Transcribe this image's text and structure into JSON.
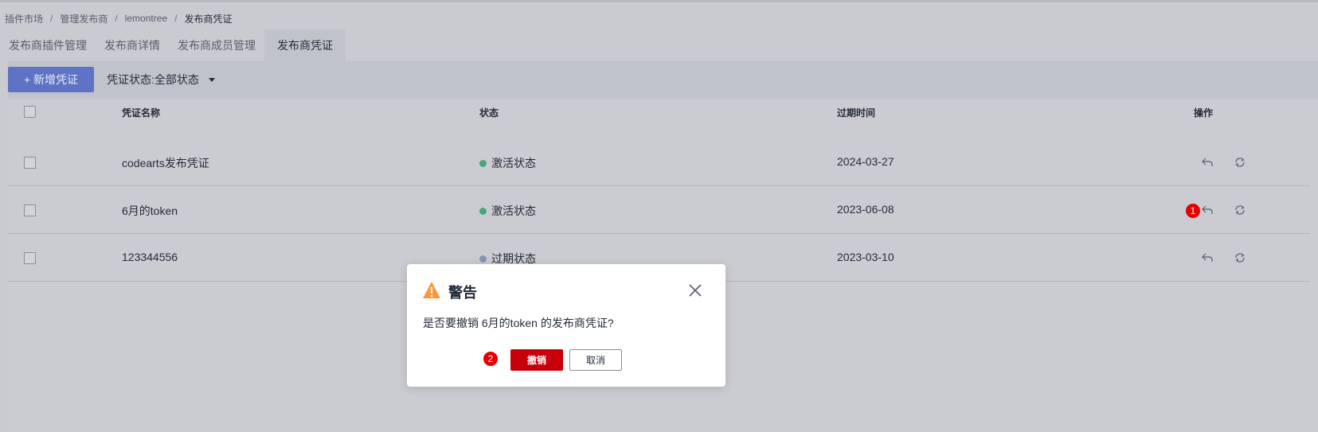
{
  "breadcrumb": {
    "items": [
      "插件市场",
      "管理发布商",
      "lemontree",
      "发布商凭证"
    ],
    "separator": "/"
  },
  "tabs": [
    {
      "label": "发布商插件管理",
      "active": false
    },
    {
      "label": "发布商详情",
      "active": false
    },
    {
      "label": "发布商成员管理",
      "active": false
    },
    {
      "label": "发布商凭证",
      "active": true
    }
  ],
  "toolbar": {
    "new_button_label": "+ 新增凭证",
    "filter_label": "凭证状态:",
    "filter_value": "全部状态"
  },
  "table": {
    "headers": {
      "name": "凭证名称",
      "status": "状态",
      "expiry": "过期时间",
      "actions": "操作"
    },
    "rows": [
      {
        "name": "codearts发布凭证",
        "status": "激活状态",
        "status_color": "#4aa57e",
        "expiry": "2024-03-27"
      },
      {
        "name": "6月的token",
        "status": "激活状态",
        "status_color": "#4aa57e",
        "expiry": "2023-06-08"
      },
      {
        "name": "123344556",
        "status": "过期状态",
        "status_color": "#8b93b5",
        "expiry": "2023-03-10"
      }
    ],
    "row_action_icons": [
      "revoke-icon",
      "refresh-icon"
    ]
  },
  "annotations": {
    "step1": "1",
    "step2": "2",
    "color": "#e60000"
  },
  "dialog": {
    "title": "警告",
    "message": "是否要撤销 6月的token 的发布商凭证?",
    "confirm_label": "撤销",
    "cancel_label": "取消",
    "icons": [
      "warning-icon",
      "close-icon"
    ]
  },
  "colors": {
    "primary_button": "#5e73c5",
    "danger_button": "#c8000a",
    "warning_icon": "#fa9841"
  }
}
